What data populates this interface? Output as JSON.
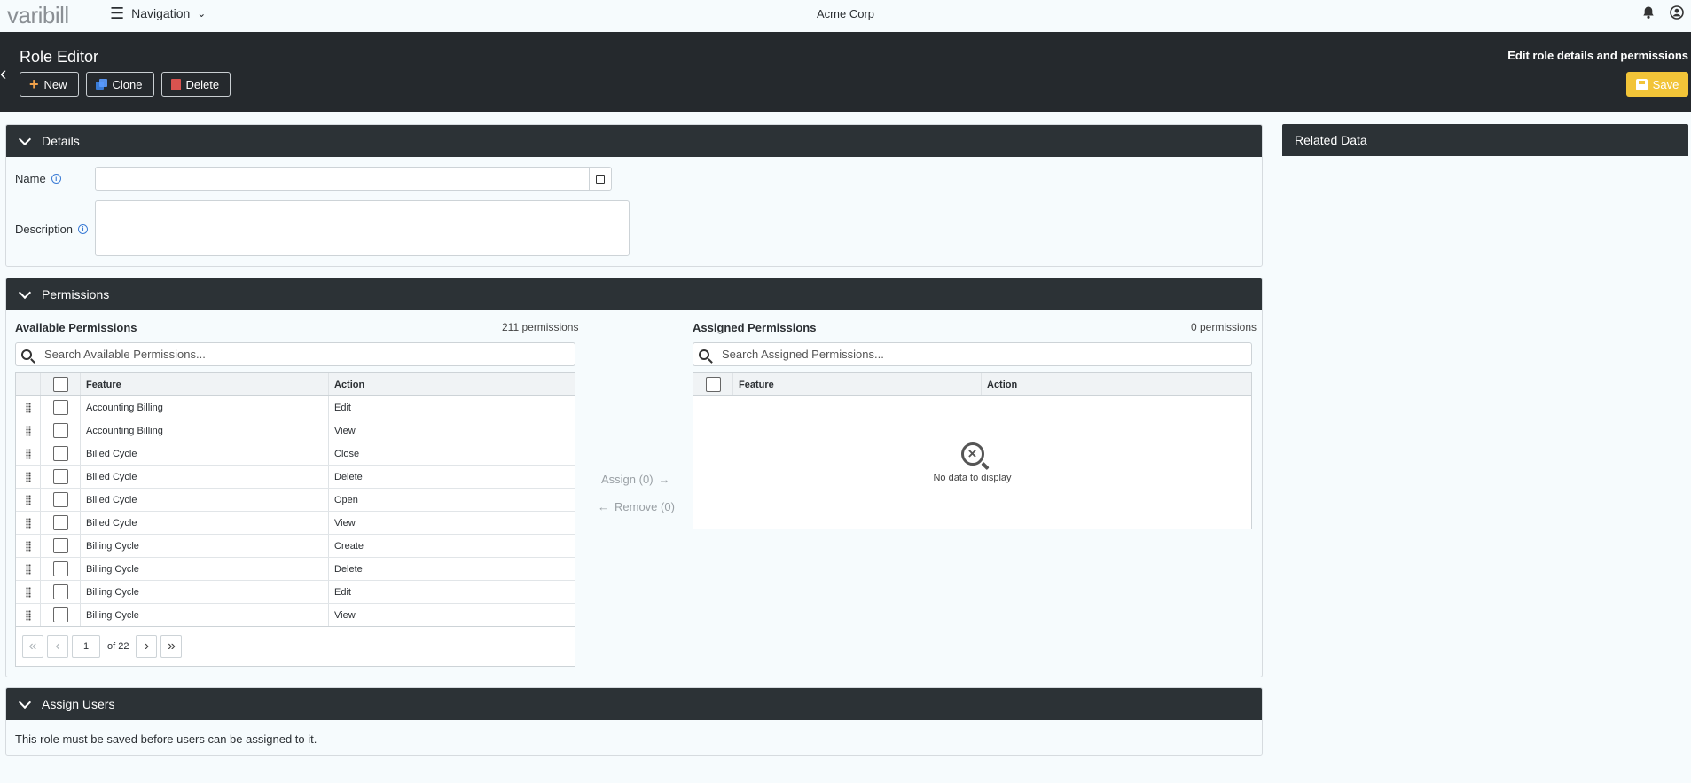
{
  "app": {
    "logo": "varibill",
    "nav_label": "Navigation",
    "company": "Acme Corp"
  },
  "header": {
    "title": "Role Editor",
    "subtitle": "Edit role details and permissions",
    "buttons": {
      "new": "New",
      "clone": "Clone",
      "delete": "Delete",
      "save": "Save"
    }
  },
  "details": {
    "heading": "Details",
    "name_label": "Name",
    "name_value": "",
    "description_label": "Description",
    "description_value": ""
  },
  "related": {
    "heading": "Related Data"
  },
  "permissions": {
    "heading": "Permissions",
    "available": {
      "title": "Available Permissions",
      "count": "211 permissions",
      "search_placeholder": "Search Available Permissions...",
      "columns": {
        "feature": "Feature",
        "action": "Action"
      },
      "rows": [
        {
          "feature": "Accounting Billing",
          "action": "Edit"
        },
        {
          "feature": "Accounting Billing",
          "action": "View"
        },
        {
          "feature": "Billed Cycle",
          "action": "Close"
        },
        {
          "feature": "Billed Cycle",
          "action": "Delete"
        },
        {
          "feature": "Billed Cycle",
          "action": "Open"
        },
        {
          "feature": "Billed Cycle",
          "action": "View"
        },
        {
          "feature": "Billing Cycle",
          "action": "Create"
        },
        {
          "feature": "Billing Cycle",
          "action": "Delete"
        },
        {
          "feature": "Billing Cycle",
          "action": "Edit"
        },
        {
          "feature": "Billing Cycle",
          "action": "View"
        }
      ],
      "pager": {
        "page": "1",
        "of_label": "of 22"
      }
    },
    "assign_label": "Assign (0)",
    "remove_label": "Remove (0)",
    "assigned": {
      "title": "Assigned Permissions",
      "count": "0 permissions",
      "search_placeholder": "Search Assigned Permissions...",
      "columns": {
        "feature": "Feature",
        "action": "Action"
      },
      "empty_text": "No data to display"
    }
  },
  "assign_users": {
    "heading": "Assign Users",
    "message": "This role must be saved before users can be assigned to it."
  }
}
